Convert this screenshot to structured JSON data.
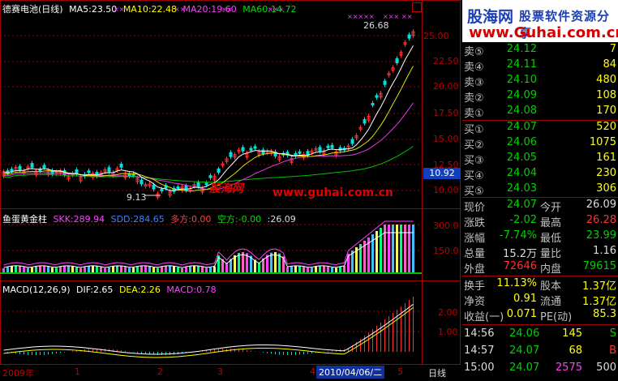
{
  "price_legend": {
    "title": "德赛电池(日线)",
    "ma5": "MA5:23.50",
    "ma10": "MA10:22.48",
    "ma20": "MA20:19.60",
    "ma60": "MA60:14.72"
  },
  "price_axis": [
    "25.00",
    "22.50",
    "20.00",
    "17.50",
    "15.00",
    "12.50",
    "10.00"
  ],
  "current_price_tag": "10.92",
  "high_label": "26.68",
  "low_label": "9.13",
  "watermark_mid": {
    "a": "股海网",
    "b": "www.guhai.com.cn"
  },
  "mid_legend": {
    "title": "鱼蛋黄金柱",
    "skk": "SKK:289.94",
    "sdd": "SDD:284.65",
    "duo": "多方:0.00",
    "kong": "空方:-0.00",
    "extra": ":26.09"
  },
  "mid_axis": [
    "300.0",
    "150.0"
  ],
  "macd_legend": {
    "title": "MACD(12,26,9)",
    "dif": "DIF:2.65",
    "dea": "DEA:2.26",
    "macd": "MACD:0.78"
  },
  "macd_axis": [
    "2.00",
    "1.00"
  ],
  "x_axis": {
    "year": "2009年",
    "m1": "1",
    "m2": "2",
    "m3": "3",
    "m4": "4",
    "date": "2010/04/06/二",
    "m5": "5",
    "period": "日线"
  },
  "brand": {
    "top": "股海网",
    "sub": "股票软件资源分享",
    "url": "www.Guhai.com.cn"
  },
  "sell_orders": [
    {
      "label": "卖⑤",
      "price": "24.12",
      "vol": "7"
    },
    {
      "label": "卖④",
      "price": "24.11",
      "vol": "84"
    },
    {
      "label": "卖③",
      "price": "24.10",
      "vol": "480"
    },
    {
      "label": "卖②",
      "price": "24.09",
      "vol": "108"
    },
    {
      "label": "卖①",
      "price": "24.08",
      "vol": "170"
    }
  ],
  "buy_orders": [
    {
      "label": "买①",
      "price": "24.07",
      "vol": "520"
    },
    {
      "label": "买②",
      "price": "24.06",
      "vol": "1075"
    },
    {
      "label": "买③",
      "price": "24.05",
      "vol": "161"
    },
    {
      "label": "买④",
      "price": "24.04",
      "vol": "230"
    },
    {
      "label": "买⑤",
      "price": "24.03",
      "vol": "306"
    }
  ],
  "quote": [
    {
      "l1": "现价",
      "v1": "24.07",
      "c1": "green",
      "l2": "今开",
      "v2": "26.09",
      "c2": "white"
    },
    {
      "l1": "涨跌",
      "v1": "-2.02",
      "c1": "green",
      "l2": "最高",
      "v2": "26.28",
      "c2": "red"
    },
    {
      "l1": "涨幅",
      "v1": "-7.74%",
      "c1": "green",
      "l2": "最低",
      "v2": "23.99",
      "c2": "green"
    },
    {
      "l1": "总量",
      "v1": "15.2万",
      "c1": "white",
      "l2": "量比",
      "v2": "1.16",
      "c2": "white"
    },
    {
      "l1": "外盘",
      "v1": "72646",
      "c1": "red",
      "l2": "内盘",
      "v2": "79615",
      "c2": "green"
    }
  ],
  "stats": [
    {
      "l1": "换手",
      "v1": "11.13%",
      "l2": "股本",
      "v2": "1.37亿"
    },
    {
      "l1": "净资",
      "v1": "0.91",
      "l2": "流通",
      "v2": "1.37亿"
    },
    {
      "l1": "收益(一)",
      "v1": "0.071",
      "l2": "PE(动)",
      "v2": "85.3"
    }
  ],
  "ticks": [
    {
      "time": "14:56",
      "price": "24.06",
      "vol": "145",
      "flag": "S"
    },
    {
      "time": "14:57",
      "price": "24.07",
      "vol": "68",
      "flag": "B"
    },
    {
      "time": "15:00",
      "price": "24.07",
      "vol": "2575",
      "flag": "500"
    }
  ]
}
